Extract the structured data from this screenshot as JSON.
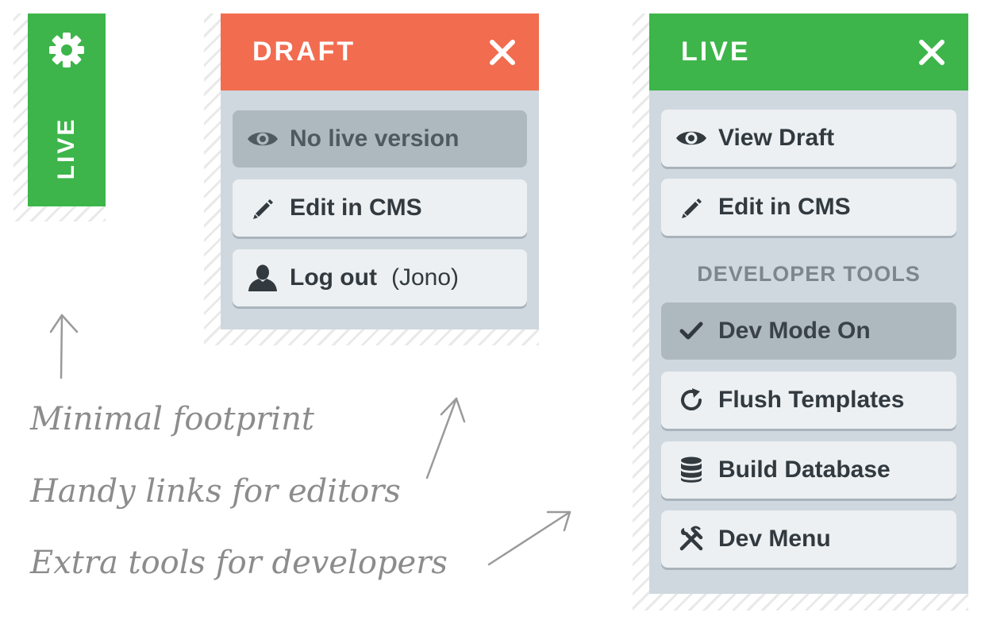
{
  "colors": {
    "live": "#3db54a",
    "draft": "#f26c50",
    "panel_bg": "#d0d8df",
    "button_bg": "#ecf0f2",
    "button_muted_bg": "#aeb8bf",
    "text": "#323a40",
    "note_text": "#8c8c8c"
  },
  "collapsed_tab": {
    "icon": "gear-icon",
    "label": "LIVE"
  },
  "draft_panel": {
    "title": "DRAFT",
    "close_icon": "close-icon",
    "buttons": [
      {
        "label": "No live version",
        "icon": "eye-icon",
        "state": "disabled"
      },
      {
        "label": "Edit in CMS",
        "icon": "pencil-icon"
      },
      {
        "label": "Log out",
        "extra": "(Jono)",
        "icon": "user-icon"
      }
    ]
  },
  "live_panel": {
    "title": "LIVE",
    "close_icon": "close-icon",
    "buttons": [
      {
        "label": "View Draft",
        "icon": "eye-icon"
      },
      {
        "label": "Edit in CMS",
        "icon": "pencil-icon"
      }
    ],
    "developer_section_label": "DEVELOPER TOOLS",
    "dev_buttons": [
      {
        "label": "Dev Mode On",
        "icon": "checkmark-icon",
        "state": "active"
      },
      {
        "label": "Flush Templates",
        "icon": "refresh-icon"
      },
      {
        "label": "Build Database",
        "icon": "database-icon"
      },
      {
        "label": "Dev Menu",
        "icon": "tools-icon"
      }
    ]
  },
  "annotations": [
    "Minimal footprint",
    "Handy links for editors",
    "Extra tools for developers"
  ]
}
